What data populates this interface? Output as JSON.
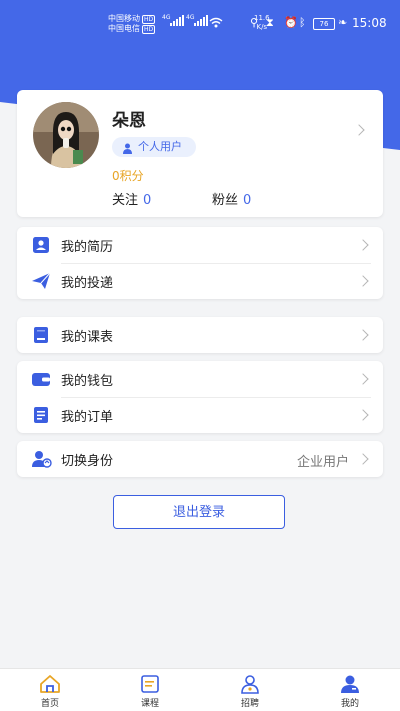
{
  "status_bar": {
    "carrier1": "中国移动",
    "carrier2": "中国电信",
    "hd": "HD",
    "net_type": "4G",
    "speed_value": "11.6",
    "speed_unit": "K/s",
    "battery": "76",
    "time": "15:08"
  },
  "profile": {
    "name": "朵恩",
    "user_type": "个人用户",
    "points": "0积分",
    "follow_label": "关注",
    "follow_count": "0",
    "fans_label": "粉丝",
    "fans_count": "0"
  },
  "menu": {
    "resume": "我的简历",
    "delivery": "我的投递",
    "schedule": "我的课表",
    "wallet": "我的钱包",
    "orders": "我的订单",
    "switch_identity": "切换身份",
    "switch_value": "企业用户"
  },
  "logout_label": "退出登录",
  "tabs": [
    {
      "label": "首页",
      "icon": "home-icon"
    },
    {
      "label": "课程",
      "icon": "book-icon"
    },
    {
      "label": "招聘",
      "icon": "recruit-icon"
    },
    {
      "label": "我的",
      "icon": "person-icon"
    }
  ],
  "colors": {
    "primary": "#4468e8",
    "points": "#e8a526",
    "background": "#f3f4f6"
  }
}
